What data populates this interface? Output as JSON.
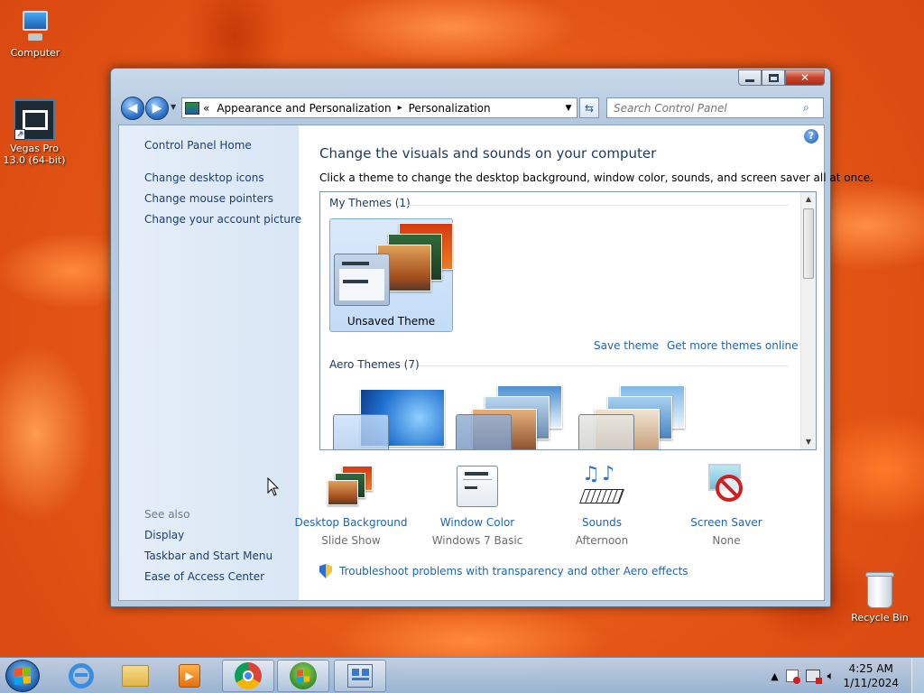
{
  "desktop": {
    "icons": [
      {
        "label": "Computer",
        "icon": "computer-icon"
      },
      {
        "label": "Vegas Pro 13.0 (64-bit)",
        "line1": "Vegas Pro",
        "line2": "13.0 (64-bit)",
        "icon": "vegas-pro-icon"
      },
      {
        "label": "Recycle Bin",
        "icon": "recycle-bin-icon"
      }
    ]
  },
  "window": {
    "controls": {
      "minimize": "▭",
      "maximize": "▢",
      "close": "✕"
    },
    "address": {
      "chevron": "«",
      "crumbs": [
        "Appearance and Personalization",
        "Personalization"
      ],
      "separator": "▸"
    },
    "search": {
      "placeholder": "Search Control Panel"
    },
    "left_pane": {
      "home": "Control Panel Home",
      "links": [
        "Change desktop icons",
        "Change mouse pointers",
        "Change your account picture"
      ],
      "see_also_title": "See also",
      "see_also": [
        "Display",
        "Taskbar and Start Menu",
        "Ease of Access Center"
      ]
    },
    "main": {
      "title": "Change the visuals and sounds on your computer",
      "subtitle": "Click a theme to change the desktop background, window color, sounds, and screen saver all at once.",
      "my_themes_header": "My Themes (1)",
      "selected_theme": "Unsaved Theme",
      "save_theme": "Save theme",
      "get_more": "Get more themes online",
      "aero_header": "Aero Themes (7)"
    },
    "settings": [
      {
        "label": "Desktop Background",
        "value": "Slide Show",
        "icon": "desktop-background-icon"
      },
      {
        "label": "Window Color",
        "value": "Windows 7 Basic",
        "icon": "window-color-icon"
      },
      {
        "label": "Sounds",
        "value": "Afternoon",
        "icon": "sounds-icon"
      },
      {
        "label": "Screen Saver",
        "value": "None",
        "icon": "screen-saver-icon"
      }
    ],
    "troubleshoot": "Troubleshoot problems with transparency and other Aero effects"
  },
  "taskbar": {
    "pinned": [
      "start-button",
      "internet-explorer",
      "windows-explorer",
      "windows-media-player",
      "google-chrome",
      "windows-7-app",
      "control-panel"
    ],
    "clock": {
      "time": "4:25 AM",
      "date": "1/11/2024"
    }
  },
  "colors": {
    "link": "#1f64b2",
    "heading": "#1e395b",
    "nav_pane": "#e5eef8"
  }
}
